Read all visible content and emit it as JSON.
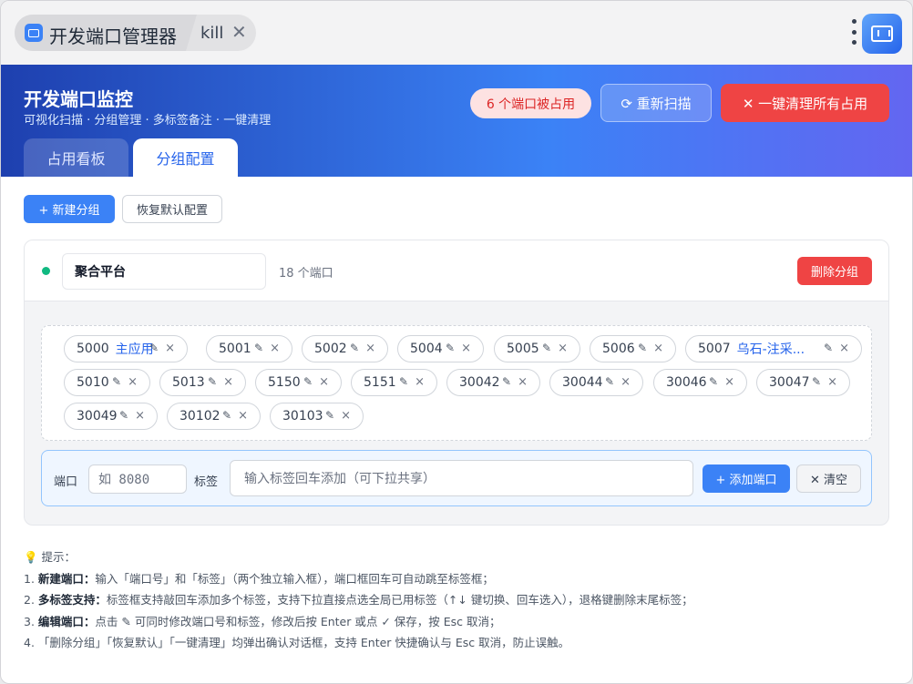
{
  "window": {
    "app_title": "开发端口管理器",
    "second_tab": "kill",
    "close_glyph": "✕"
  },
  "header": {
    "title": "开发端口监控",
    "subtitle": "可视化扫描 · 分组管理 · 多标签备注 · 一键清理",
    "occupied_badge": "6 个端口被占用",
    "rescan_label": "⟳ 重新扫描",
    "clear_all_label": "✕ 一键清理所有占用",
    "tabs": [
      {
        "label": "占用看板",
        "active": false
      },
      {
        "label": "分组配置",
        "active": true
      }
    ]
  },
  "toolbar": {
    "new_group_label": "+ 新建分组",
    "restore_label": "恢复默认配置"
  },
  "group": {
    "name": "聚合平台",
    "count_label": "18 个端口",
    "delete_label": "删除分组",
    "status_color": "#10b981",
    "ports": [
      {
        "port": "5000",
        "tag": "主应用"
      },
      {
        "port": "5001",
        "tag": ""
      },
      {
        "port": "5002",
        "tag": ""
      },
      {
        "port": "5004",
        "tag": ""
      },
      {
        "port": "5005",
        "tag": ""
      },
      {
        "port": "5006",
        "tag": ""
      },
      {
        "port": "5007",
        "tag": "乌石-注采..."
      },
      {
        "port": "5010",
        "tag": ""
      },
      {
        "port": "5013",
        "tag": ""
      },
      {
        "port": "5150",
        "tag": ""
      },
      {
        "port": "5151",
        "tag": ""
      },
      {
        "port": "30042",
        "tag": ""
      },
      {
        "port": "30044",
        "tag": ""
      },
      {
        "port": "30046",
        "tag": ""
      },
      {
        "port": "30047",
        "tag": ""
      },
      {
        "port": "30049",
        "tag": ""
      },
      {
        "port": "30102",
        "tag": ""
      },
      {
        "port": "30103",
        "tag": ""
      }
    ],
    "edit_glyph": "✎",
    "remove_glyph": "×"
  },
  "add_port": {
    "port_label": "端口",
    "port_placeholder": "如 8080",
    "tag_label": "标签",
    "tag_placeholder": "输入标签回车添加（可下拉共享）",
    "add_label": "+ 添加端口",
    "clear_label": "✕ 清空"
  },
  "tips": {
    "heading": "💡 提示：",
    "lines": [
      [
        "1. ",
        "新建端口：",
        "输入「端口号」和「标签」（两个独立输入框），端口框回车可自动跳至标签框；"
      ],
      [
        "2. ",
        "多标签支持：",
        "标签框支持敲回车添加多个标签，支持下拉直接点选全局已用标签（↑↓ 键切换、回车选入），退格键删除末尾标签；"
      ],
      [
        "3. ",
        "编辑端口：",
        "点击 ✎ 可同时修改端口号和标签，修改后按 Enter 或点 ✓ 保存，按 Esc 取消；"
      ],
      [
        "4. ",
        "",
        "「删除分组」「恢复默认」「一键清理」均弹出确认对话框，支持 Enter 快捷确认与 Esc 取消，防止误触。"
      ]
    ]
  }
}
